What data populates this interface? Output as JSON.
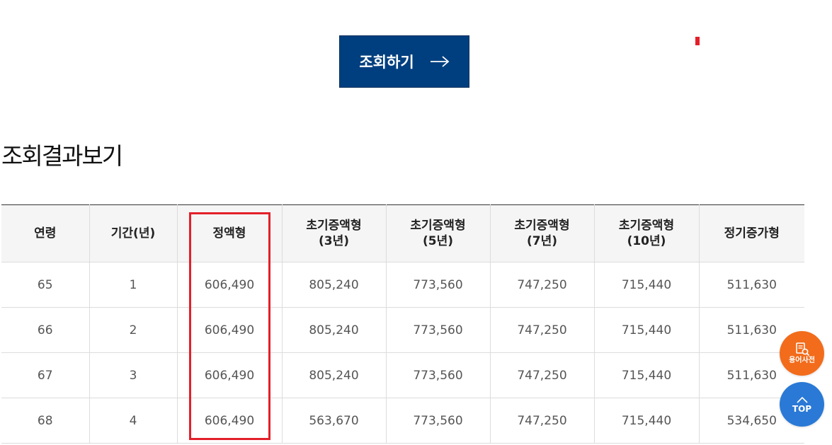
{
  "search_button": {
    "label": "조회하기",
    "icon": "arrow-right-icon"
  },
  "section": {
    "title": "조회결과보기"
  },
  "table": {
    "headers": [
      {
        "line1": "연령",
        "line2": ""
      },
      {
        "line1": "기간(년)",
        "line2": ""
      },
      {
        "line1": "정액형",
        "line2": ""
      },
      {
        "line1": "초기증액형",
        "line2": "(3년)"
      },
      {
        "line1": "초기증액형",
        "line2": "(5년)"
      },
      {
        "line1": "초기증액형",
        "line2": "(7년)"
      },
      {
        "line1": "초기증액형",
        "line2": "(10년)"
      },
      {
        "line1": "정기증가형",
        "line2": ""
      }
    ],
    "rows": [
      [
        "65",
        "1",
        "606,490",
        "805,240",
        "773,560",
        "747,250",
        "715,440",
        "511,630"
      ],
      [
        "66",
        "2",
        "606,490",
        "805,240",
        "773,560",
        "747,250",
        "715,440",
        "511,630"
      ],
      [
        "67",
        "3",
        "606,490",
        "805,240",
        "773,560",
        "747,250",
        "715,440",
        "511,630"
      ],
      [
        "68",
        "4",
        "606,490",
        "563,670",
        "773,560",
        "747,250",
        "715,440",
        "534,650"
      ]
    ]
  },
  "floating": {
    "dictionary": {
      "label": "용어사전",
      "icon": "book-search-icon"
    },
    "top": {
      "label": "TOP",
      "icon": "chevron-up-icon"
    }
  },
  "colors": {
    "button": "#003f7f",
    "highlight": "#e3202a",
    "dictionary": "#f26c1c",
    "top": "#2a79d6"
  }
}
